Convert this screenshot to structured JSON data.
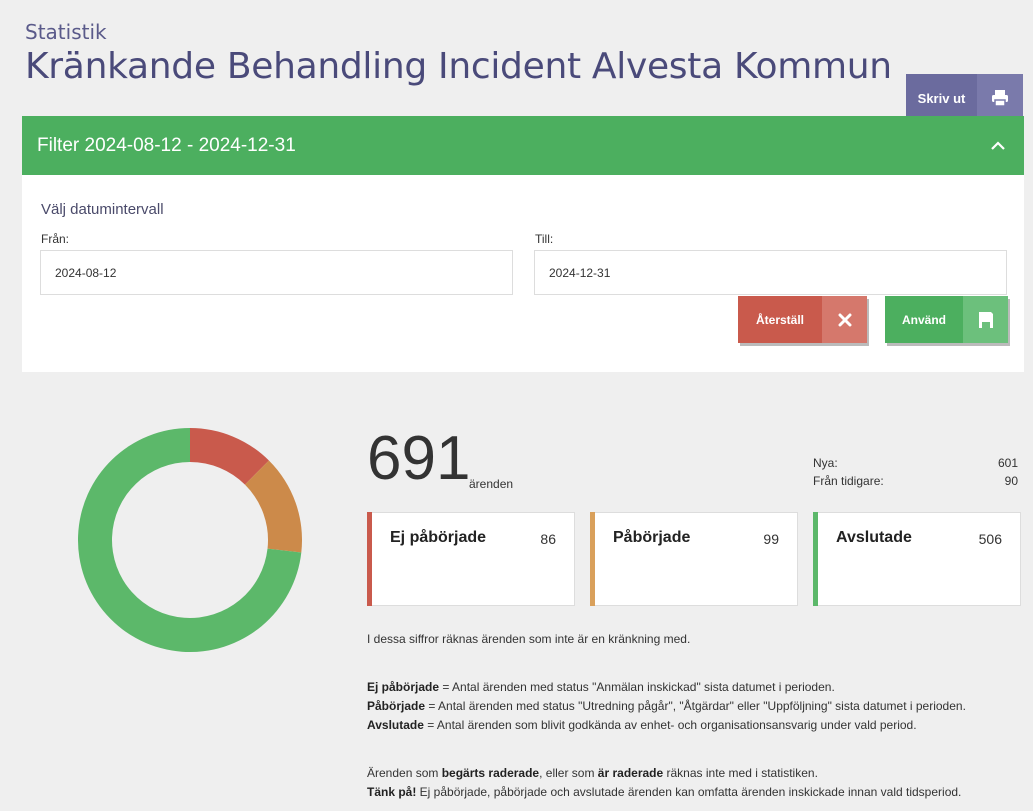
{
  "header": {
    "subtitle": "Statistik",
    "title": "Kränkande Behandling Incident Alvesta Kommun",
    "print_label": "Skriv ut",
    "print_icon": "printer-icon"
  },
  "filter": {
    "title": "Filter 2024-08-12 - 2024-12-31",
    "collapse_icon": "chevron-up-icon",
    "heading": "Välj datumintervall",
    "from_label": "Från:",
    "from_value": "2024-08-12",
    "to_label": "Till:",
    "to_value": "2024-12-31",
    "reset_label": "Återställ",
    "reset_icon": "close-icon",
    "apply_label": "Använd",
    "apply_icon": "save-icon"
  },
  "summary": {
    "total": "691",
    "total_unit": "ärenden",
    "new_label": "Nya:",
    "new_value": "601",
    "previous_label": "Från tidigare:",
    "previous_value": "90"
  },
  "cards": [
    {
      "label": "Ej påbörjade",
      "value": "86",
      "color": "#c95a4c"
    },
    {
      "label": "Påbörjade",
      "value": "99",
      "color": "#d9a05b"
    },
    {
      "label": "Avslutade",
      "value": "506",
      "color": "#5cb86a"
    }
  ],
  "chart_data": {
    "type": "pie",
    "categories": [
      "Ej påbörjade",
      "Påbörjade",
      "Avslutade"
    ],
    "values": [
      86,
      99,
      506
    ],
    "colors": [
      "#c95a4c",
      "#cc8a4a",
      "#5cb86a"
    ],
    "donut": true
  },
  "info": {
    "line1": "I dessa siffror räknas ärenden som inte är en kränkning med.",
    "def1_term": "Ej påbörjade",
    "def1_text": " = Antal ärenden med status \"Anmälan inskickad\" sista datumet i perioden.",
    "def2_term": "Påbörjade",
    "def2_text": " = Antal ärenden med status \"Utredning pågår\", \"Åtgärdar\" eller \"Uppföljning\" sista datumet i perioden.",
    "def3_term": "Avslutade",
    "def3_text": " = Antal ärenden som blivit godkända av enhet- och organisationsansvarig under vald period.",
    "del_a": "Ärenden som ",
    "del_b": "begärts raderade",
    "del_c": ", eller som ",
    "del_d": "är raderade",
    "del_e": " räknas inte med i statistiken.",
    "note_term": "Tänk på!",
    "note_text": " Ej påbörjade, påbörjade och avslutade ärenden kan omfatta ärenden inskickade innan vald tidsperiod."
  }
}
